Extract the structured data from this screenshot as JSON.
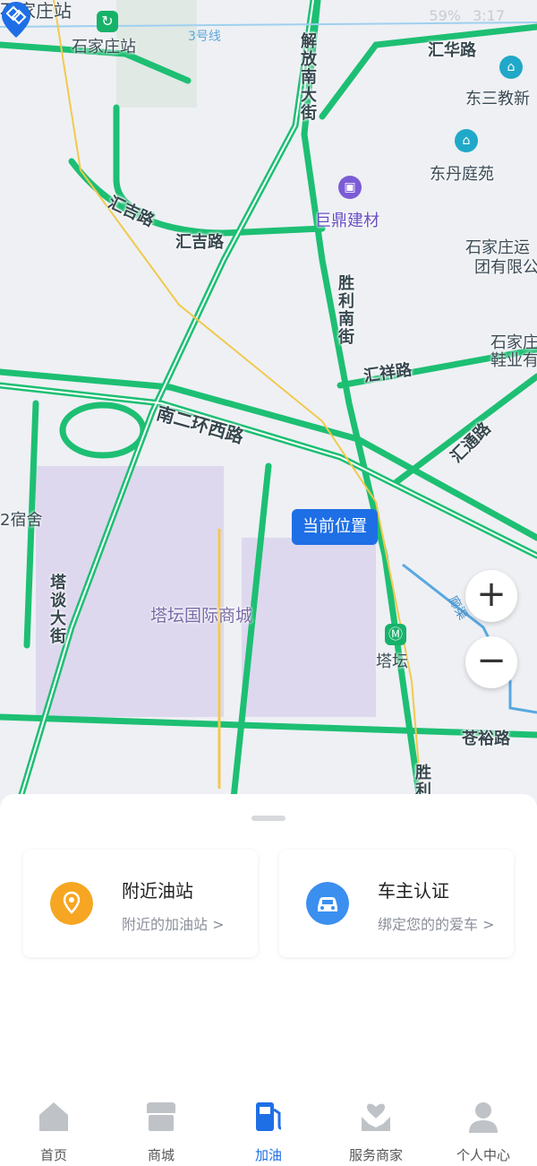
{
  "status_bar": {
    "battery": "59%",
    "time": "3:17"
  },
  "map": {
    "labels": {
      "shijiazhuang_station_top": "石家庄站",
      "shijiazhuang_station": "石家庄站",
      "metro_line": "3号线",
      "jiefang_south": "解放南大街",
      "huihua_road": "汇华路",
      "dongsan": "东三教新",
      "dongdan": "东丹庭苑",
      "huiji_road_1": "汇吉路",
      "huiji_road_2": "汇吉路",
      "juding": "巨鼎建材",
      "yunsheng": "石家庄运",
      "yunsheng2": "团有限公",
      "shengli_south": "胜利南街",
      "huixiang_road": "汇祥路",
      "xieye": "石家庄",
      "xieye2": "鞋业有",
      "nan2huan": "南二环西路",
      "huitong_road": "汇通路",
      "dormitory": "2宿舍",
      "tatan_market": "塔坛国际商城",
      "tatan_street": "塔谈大街",
      "tatan_station": "塔坛",
      "canglu_road": "苍裕路",
      "shengli_bottom": "胜利",
      "canal": "廊渠"
    },
    "current_location": "当前位置",
    "zoom_in": "+",
    "zoom_out": "−"
  },
  "cards": [
    {
      "title": "附近油站",
      "subtitle": "附近的加油站 >",
      "icon": "location-pin-icon",
      "color": "#f6a623"
    },
    {
      "title": "车主认证",
      "subtitle": "绑定您的的爱车 >",
      "icon": "car-icon",
      "color": "#3b8fef"
    }
  ],
  "tabs": [
    {
      "label": "首页",
      "icon": "home-icon"
    },
    {
      "label": "商城",
      "icon": "shop-icon"
    },
    {
      "label": "加油",
      "icon": "fuel-pump-icon"
    },
    {
      "label": "服务商家",
      "icon": "heart-hands-icon"
    },
    {
      "label": "个人中心",
      "icon": "user-icon"
    }
  ],
  "colors": {
    "accent": "#1e6fe6",
    "road": "#1dbf73",
    "inactive": "#bfc3c8"
  }
}
